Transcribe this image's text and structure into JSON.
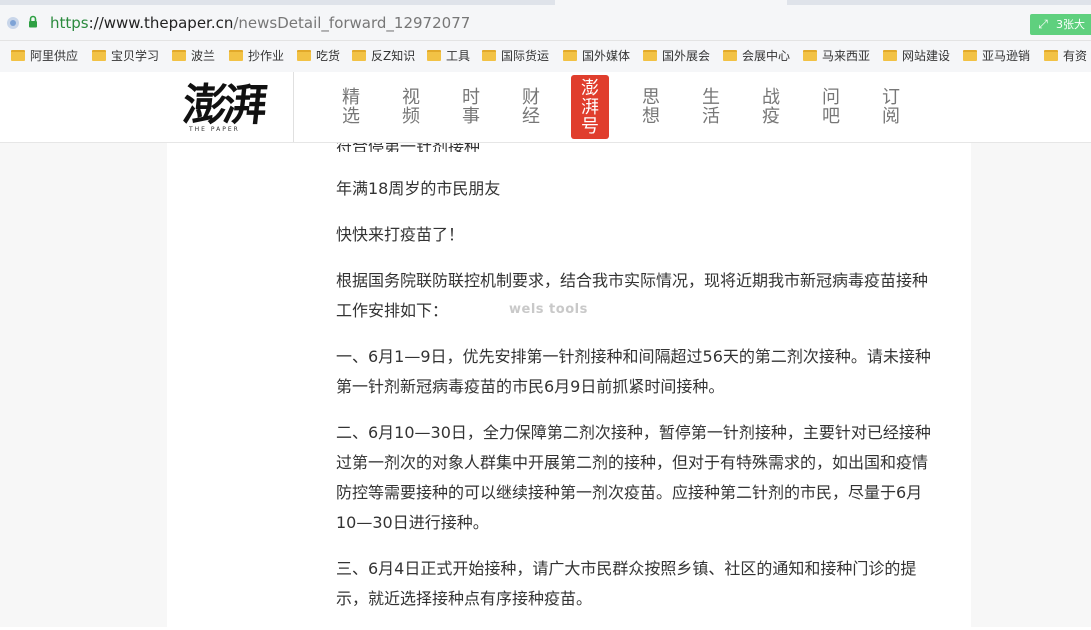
{
  "browser": {
    "url_proto": "https",
    "url_host": "://www.thepaper.cn",
    "url_path": "/newsDetail_forward_12972077",
    "extension_label": "3张大",
    "extension_icon": "expand-icon"
  },
  "bookmarks": [
    {
      "label": "阿里供应"
    },
    {
      "label": "宝贝学习"
    },
    {
      "label": "波兰"
    },
    {
      "label": "抄作业"
    },
    {
      "label": "吃货"
    },
    {
      "label": "反Z知识"
    },
    {
      "label": "工具"
    },
    {
      "label": "国际货运"
    },
    {
      "label": "国外媒体"
    },
    {
      "label": "国外展会"
    },
    {
      "label": "会展中心"
    },
    {
      "label": "马来西亚"
    },
    {
      "label": "网站建设"
    },
    {
      "label": "亚马逊销"
    },
    {
      "label": "有资"
    }
  ],
  "site": {
    "logo_text": "澎湃",
    "logo_sub": "THE PAPER",
    "nav": [
      {
        "label": "精选"
      },
      {
        "label": "视频"
      },
      {
        "label": "时事"
      },
      {
        "label": "财经"
      },
      {
        "label": "澎湃号",
        "highlight": true
      },
      {
        "label": "思想"
      },
      {
        "label": "生活"
      },
      {
        "label": "战疫"
      },
      {
        "label": "问吧"
      },
      {
        "label": "订阅"
      }
    ],
    "accent_color": "#e03e2d"
  },
  "article": {
    "clipped_line": "符合停第一针剂接种",
    "paragraphs": [
      "年满18周岁的市民朋友",
      "快快来打疫苗了！",
      "根据国务院联防联控机制要求，结合我市实际情况，现将近期我市新冠病毒疫苗接种工作安排如下：",
      "一、6月1—9日，优先安排第一针剂接种和间隔超过56天的第二剂次接种。请未接种第一针剂新冠病毒疫苗的市民6月9日前抓紧时间接种。",
      "二、6月10—30日，全力保障第二剂次接种，暂停第一针剂接种，主要针对已经接种过第一剂次的对象人群集中开展第二剂的接种，但对于有特殊需求的，如出国和疫情防控等需要接种的可以继续接种第一剂次疫苗。应接种第二针剂的市民，尽量于6月10—30日进行接种。",
      "三、6月4日正式开始接种，请广大市民群众按照乡镇、社区的通知和接种门诊的提示，就近选择接种点有序接种疫苗。"
    ],
    "watermark": "wels tools"
  }
}
